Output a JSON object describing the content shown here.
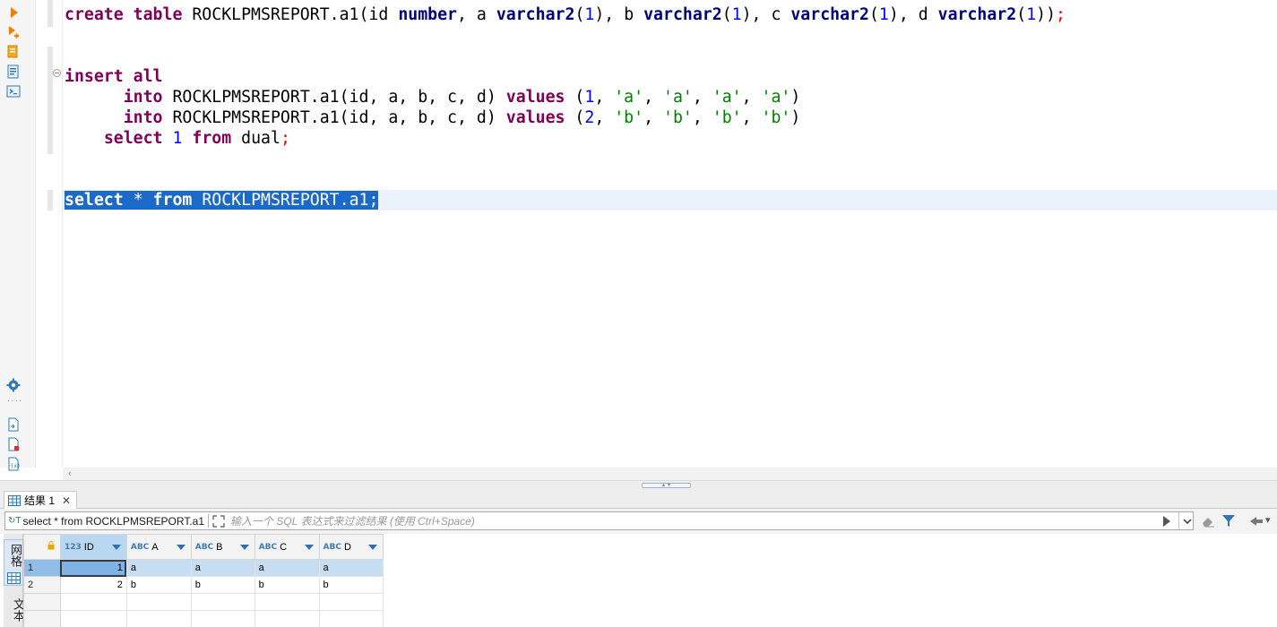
{
  "editor": {
    "lines": [
      {
        "segments": [
          {
            "t": "create",
            "c": "kw"
          },
          {
            "t": " ",
            "c": "plain"
          },
          {
            "t": "table",
            "c": "kw"
          },
          {
            "t": " ROCKLPMSREPORT.a1(id ",
            "c": "plain"
          },
          {
            "t": "number",
            "c": "kt"
          },
          {
            "t": ", a ",
            "c": "plain"
          },
          {
            "t": "varchar2",
            "c": "kt"
          },
          {
            "t": "(",
            "c": "plain"
          },
          {
            "t": "1",
            "c": "num"
          },
          {
            "t": "), b ",
            "c": "plain"
          },
          {
            "t": "varchar2",
            "c": "kt"
          },
          {
            "t": "(",
            "c": "plain"
          },
          {
            "t": "1",
            "c": "num"
          },
          {
            "t": "), c ",
            "c": "plain"
          },
          {
            "t": "varchar2",
            "c": "kt"
          },
          {
            "t": "(",
            "c": "plain"
          },
          {
            "t": "1",
            "c": "num"
          },
          {
            "t": "), d ",
            "c": "plain"
          },
          {
            "t": "varchar2",
            "c": "kt"
          },
          {
            "t": "(",
            "c": "plain"
          },
          {
            "t": "1",
            "c": "num"
          },
          {
            "t": "))",
            "c": "plain"
          },
          {
            "t": ";",
            "c": "semi"
          }
        ]
      },
      {
        "segments": []
      },
      {
        "segments": []
      },
      {
        "segments": [
          {
            "t": "insert",
            "c": "kw"
          },
          {
            "t": " ",
            "c": "plain"
          },
          {
            "t": "all",
            "c": "kw"
          }
        ]
      },
      {
        "segments": [
          {
            "t": "      ",
            "c": "plain"
          },
          {
            "t": "into",
            "c": "kw"
          },
          {
            "t": " ROCKLPMSREPORT.a1(id, a, b, c, d) ",
            "c": "plain"
          },
          {
            "t": "values",
            "c": "kw"
          },
          {
            "t": " (",
            "c": "plain"
          },
          {
            "t": "1",
            "c": "num"
          },
          {
            "t": ", ",
            "c": "plain"
          },
          {
            "t": "'a'",
            "c": "str"
          },
          {
            "t": ", ",
            "c": "plain"
          },
          {
            "t": "'a'",
            "c": "str"
          },
          {
            "t": ", ",
            "c": "plain"
          },
          {
            "t": "'a'",
            "c": "str"
          },
          {
            "t": ", ",
            "c": "plain"
          },
          {
            "t": "'a'",
            "c": "str"
          },
          {
            "t": ")",
            "c": "plain"
          }
        ]
      },
      {
        "segments": [
          {
            "t": "      ",
            "c": "plain"
          },
          {
            "t": "into",
            "c": "kw"
          },
          {
            "t": " ROCKLPMSREPORT.a1(id, a, b, c, d) ",
            "c": "plain"
          },
          {
            "t": "values",
            "c": "kw"
          },
          {
            "t": " (",
            "c": "plain"
          },
          {
            "t": "2",
            "c": "num"
          },
          {
            "t": ", ",
            "c": "plain"
          },
          {
            "t": "'b'",
            "c": "str"
          },
          {
            "t": ", ",
            "c": "plain"
          },
          {
            "t": "'b'",
            "c": "str"
          },
          {
            "t": ", ",
            "c": "plain"
          },
          {
            "t": "'b'",
            "c": "str"
          },
          {
            "t": ", ",
            "c": "plain"
          },
          {
            "t": "'b'",
            "c": "str"
          },
          {
            "t": ")",
            "c": "plain"
          }
        ]
      },
      {
        "segments": [
          {
            "t": "    ",
            "c": "plain"
          },
          {
            "t": "select",
            "c": "kw"
          },
          {
            "t": " ",
            "c": "plain"
          },
          {
            "t": "1",
            "c": "num"
          },
          {
            "t": " ",
            "c": "plain"
          },
          {
            "t": "from",
            "c": "kw"
          },
          {
            "t": " dual",
            "c": "plain"
          },
          {
            "t": ";",
            "c": "semi"
          }
        ]
      },
      {
        "segments": []
      },
      {
        "segments": []
      },
      {
        "selected": true,
        "segments": [
          {
            "t": "select",
            "c": "kw"
          },
          {
            "t": " * ",
            "c": "plain"
          },
          {
            "t": "from",
            "c": "kw"
          },
          {
            "t": " ROCKLPMSREPORT.a1",
            "c": "plain"
          },
          {
            "t": ";",
            "c": "semi"
          }
        ]
      }
    ]
  },
  "results": {
    "tab_label": "结果 1",
    "tab_close": "✕",
    "query_text": "select * from ROCKLPMSREPORT.a1",
    "filter_placeholder": "输入一个 SQL 表达式来过滤结果 (使用 Ctrl+Space)",
    "side_tab_grid": "网格",
    "side_tab_text": "文本",
    "columns": [
      {
        "type": "123",
        "name": "ID"
      },
      {
        "type": "ABC",
        "name": "A"
      },
      {
        "type": "ABC",
        "name": "B"
      },
      {
        "type": "ABC",
        "name": "C"
      },
      {
        "type": "ABC",
        "name": "D"
      }
    ],
    "rows": [
      {
        "num": "1",
        "id": "1",
        "a": "a",
        "b": "a",
        "c": "a",
        "d": "a"
      },
      {
        "num": "2",
        "id": "2",
        "a": "b",
        "b": "b",
        "c": "b",
        "d": "b"
      }
    ]
  },
  "icons": {
    "left_toolbar": [
      "run-statement-icon",
      "run-script-icon",
      "explain-plan-icon",
      "load-plan-icon",
      "console-icon",
      "settings-icon",
      "export-icon",
      "delete-script-icon",
      "script-format-icon"
    ],
    "filter_bar": [
      "query-link-icon",
      "expand-icon",
      "run-filter-icon",
      "filter-history-dropdown-icon",
      "clear-filter-icon",
      "filter-icon",
      "back-icon"
    ]
  },
  "colors": {
    "keyword": "#7f0055",
    "type": "#000080",
    "number": "#0000ff",
    "string": "#008000",
    "semicolon": "#ff0000",
    "selection": "#1b6ac9"
  }
}
